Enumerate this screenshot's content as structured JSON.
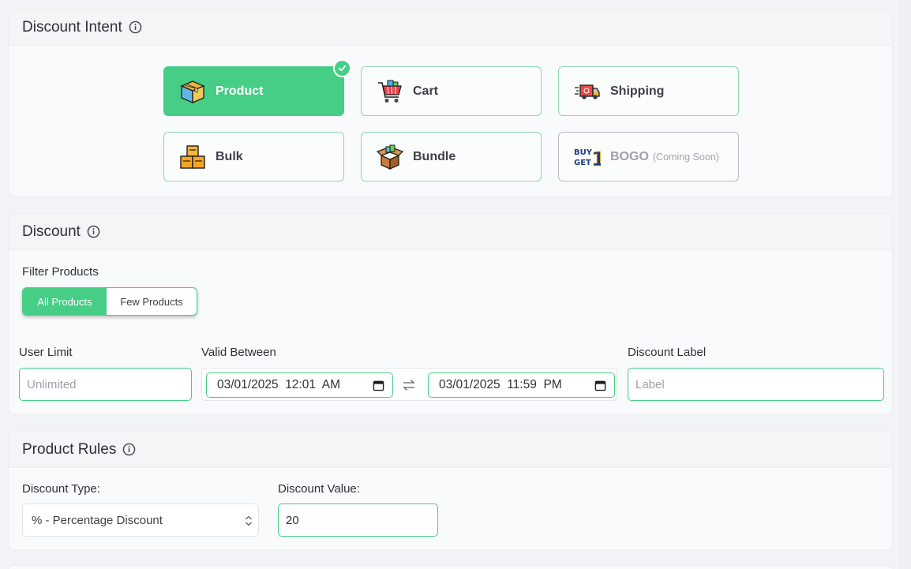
{
  "intent": {
    "title": "Discount Intent",
    "options": [
      {
        "label": "Product",
        "icon": "product-box-icon",
        "active": true
      },
      {
        "label": "Cart",
        "icon": "shopping-cart-icon"
      },
      {
        "label": "Shipping",
        "icon": "delivery-truck-icon"
      },
      {
        "label": "Bulk",
        "icon": "stacked-boxes-icon"
      },
      {
        "label": "Bundle",
        "icon": "open-box-icon"
      },
      {
        "label": "BOGO",
        "suffix": "(Coming Soon)",
        "icon": "buy-get-icon",
        "disabled": true
      }
    ],
    "bogo_logo_text": [
      "BUY",
      "GET",
      "1"
    ]
  },
  "discount": {
    "title": "Discount",
    "filter_label": "Filter Products",
    "filter_options": [
      "All Products",
      "Few Products"
    ],
    "filter_selected": "All Products",
    "user_limit_label": "User Limit",
    "user_limit_placeholder": "Unlimited",
    "valid_between_label": "Valid Between",
    "start": "03/01/2025  12:01  AM",
    "end": "03/01/2025  11:59  PM",
    "label_label": "Discount Label",
    "label_placeholder": "Label"
  },
  "rules": {
    "title": "Product Rules",
    "type_label": "Discount Type:",
    "type_value": "% - Percentage Discount",
    "value_label": "Discount Value:",
    "value": "20"
  },
  "colors": {
    "accent": "#46cd86",
    "border_accent": "#8fd7b1",
    "background": "#f2f3f6"
  }
}
